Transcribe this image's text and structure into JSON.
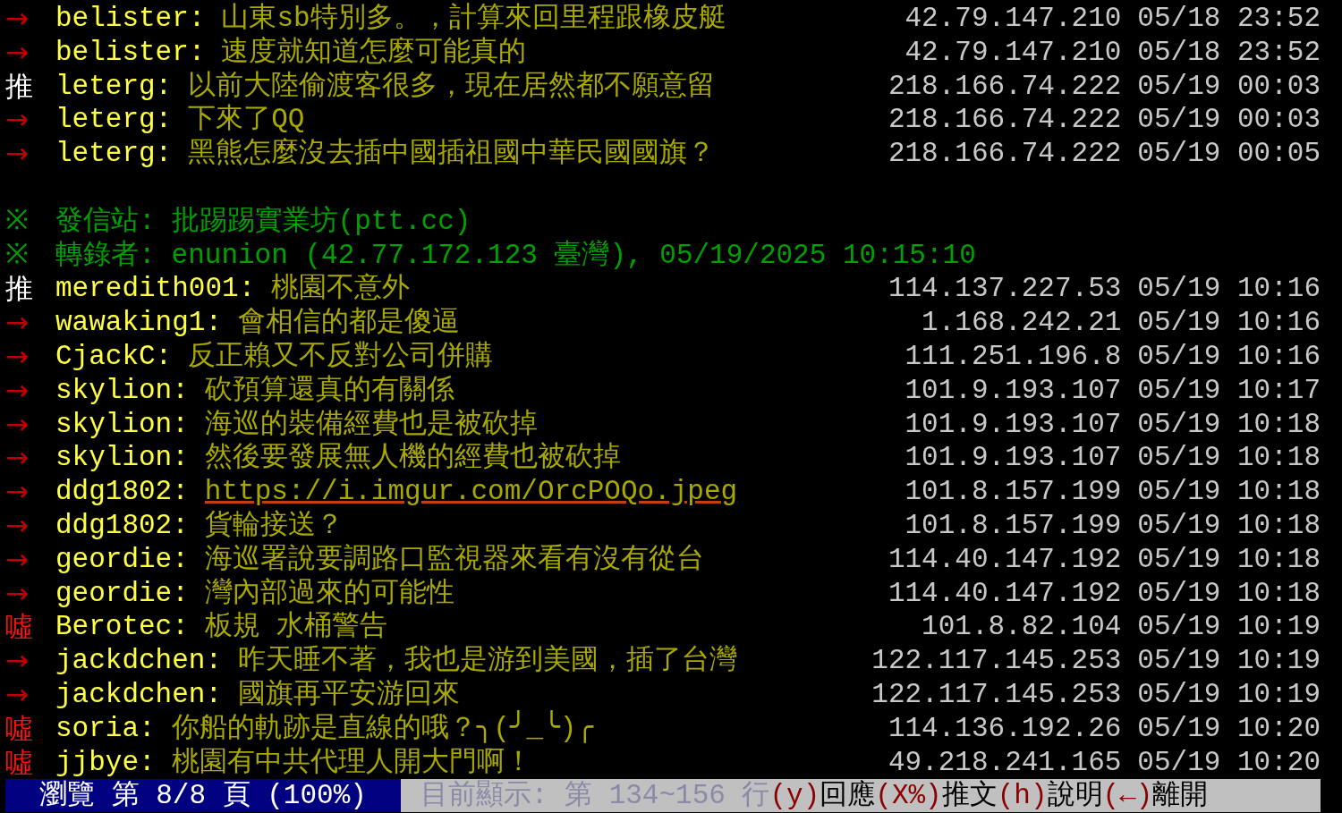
{
  "lines": [
    {
      "kind": "arrow",
      "tag": "→",
      "user": "belister:",
      "text": "山東sb特別多。，計算來回里程跟橡皮艇",
      "ip": "42.79.147.210",
      "datetime": "05/18 23:52"
    },
    {
      "kind": "arrow",
      "tag": "→",
      "user": "belister:",
      "text": "速度就知道怎麼可能真的",
      "ip": "42.79.147.210",
      "datetime": "05/18 23:52"
    },
    {
      "kind": "push",
      "tag": "推",
      "user": "leterg:",
      "text": "以前大陸偷渡客很多，現在居然都不願意留",
      "ip": "218.166.74.222",
      "datetime": "05/19 00:03"
    },
    {
      "kind": "arrow",
      "tag": "→",
      "user": "leterg:",
      "text": "下來了QQ",
      "ip": "218.166.74.222",
      "datetime": "05/19 00:03"
    },
    {
      "kind": "arrow",
      "tag": "→",
      "user": "leterg:",
      "text": "黑熊怎麼沒去插中國插祖國中華民國國旗？",
      "ip": "218.166.74.222",
      "datetime": "05/19 00:05"
    },
    {
      "kind": "blank"
    },
    {
      "kind": "signature",
      "mark": "※",
      "label": "發信站:",
      "value": "批踢踢實業坊(ptt.cc)"
    },
    {
      "kind": "signature",
      "mark": "※",
      "label": "轉錄者:",
      "value": "enunion (42.77.172.123 臺灣), 05/19/2025 10:15:10"
    },
    {
      "kind": "push",
      "tag": "推",
      "user": "meredith001:",
      "text": "桃園不意外",
      "ip": "114.137.227.53",
      "datetime": "05/19 10:16"
    },
    {
      "kind": "arrow",
      "tag": "→",
      "user": "wawaking1:",
      "text": "會相信的都是傻逼",
      "ip": "1.168.242.21",
      "datetime": "05/19 10:16"
    },
    {
      "kind": "arrow",
      "tag": "→",
      "user": "CjackC:",
      "text": "反正賴又不反對公司併購",
      "ip": "111.251.196.8",
      "datetime": "05/19 10:16"
    },
    {
      "kind": "arrow",
      "tag": "→",
      "user": "skylion:",
      "text": "砍預算還真的有關係",
      "ip": "101.9.193.107",
      "datetime": "05/19 10:17"
    },
    {
      "kind": "arrow",
      "tag": "→",
      "user": "skylion:",
      "text": "海巡的裝備經費也是被砍掉",
      "ip": "101.9.193.107",
      "datetime": "05/19 10:18"
    },
    {
      "kind": "arrow",
      "tag": "→",
      "user": "skylion:",
      "text": "然後要發展無人機的經費也被砍掉",
      "ip": "101.9.193.107",
      "datetime": "05/19 10:18"
    },
    {
      "kind": "arrow",
      "tag": "→",
      "user": "ddg1802:",
      "text": "https://i.imgur.com/OrcPOQo.jpeg",
      "is_link": true,
      "ip": "101.8.157.199",
      "datetime": "05/19 10:18"
    },
    {
      "kind": "arrow",
      "tag": "→",
      "user": "ddg1802:",
      "text": "貨輪接送？",
      "ip": "101.8.157.199",
      "datetime": "05/19 10:18"
    },
    {
      "kind": "arrow",
      "tag": "→",
      "user": "geordie:",
      "text": "海巡署說要調路口監視器來看有沒有從台",
      "ip": "114.40.147.192",
      "datetime": "05/19 10:18"
    },
    {
      "kind": "arrow",
      "tag": "→",
      "user": "geordie:",
      "text": "灣內部過來的可能性",
      "ip": "114.40.147.192",
      "datetime": "05/19 10:18"
    },
    {
      "kind": "boo",
      "tag": "噓",
      "user": "Berotec:",
      "text": "板規 水桶警告",
      "ip": "101.8.82.104",
      "datetime": "05/19 10:19"
    },
    {
      "kind": "arrow",
      "tag": "→",
      "user": "jackdchen:",
      "text": "昨天睡不著，我也是游到美國，插了台灣",
      "ip": "122.117.145.253",
      "datetime": "05/19 10:19"
    },
    {
      "kind": "arrow",
      "tag": "→",
      "user": "jackdchen:",
      "text": "國旗再平安游回來",
      "ip": "122.117.145.253",
      "datetime": "05/19 10:19"
    },
    {
      "kind": "boo",
      "tag": "噓",
      "user": "soria:",
      "text": "你船的軌跡是直線的哦？╮(╯_╰)╭",
      "ip": "114.136.192.26",
      "datetime": "05/19 10:20"
    },
    {
      "kind": "boo",
      "tag": "噓",
      "user": "jjbye:",
      "text": "桃園有中共代理人開大門啊！",
      "ip": "49.218.241.165",
      "datetime": "05/19 10:20"
    }
  ],
  "status_bar": {
    "page_info": "瀏覽 第 8/8 頁 (100%)",
    "position": "目前顯示: 第 134~156 行",
    "commands": [
      {
        "key": "(y)",
        "label": "回應"
      },
      {
        "key": "(X%)",
        "label": "推文"
      },
      {
        "key": "(h)",
        "label": "說明"
      },
      {
        "key": "(←)",
        "label": "離開"
      }
    ]
  }
}
